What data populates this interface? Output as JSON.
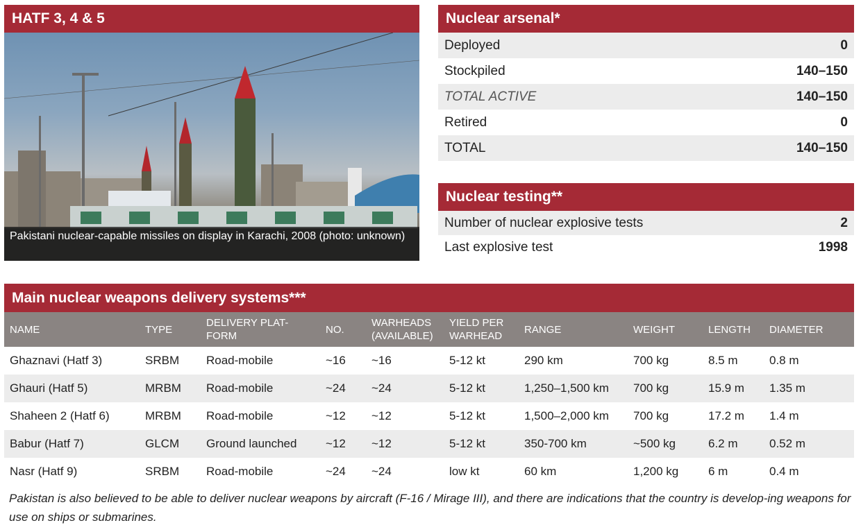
{
  "photo_panel": {
    "title": "HATF 3, 4 & 5",
    "caption": "Pakistani nuclear-capable missiles on display in Karachi, 2008 (photo: unknown)"
  },
  "arsenal": {
    "title": "Nuclear arsenal*",
    "rows": [
      {
        "label": "Deployed",
        "value": "0"
      },
      {
        "label": "Stockpiled",
        "value": "140–150"
      },
      {
        "label": "TOTAL ACTIVE",
        "value": "140–150"
      },
      {
        "label": "Retired",
        "value": "0"
      },
      {
        "label": "TOTAL",
        "value": "140–150"
      }
    ]
  },
  "testing": {
    "title": "Nuclear testing**",
    "rows": [
      {
        "label": "Number of nuclear explosive tests",
        "value": "2"
      },
      {
        "label": "Last explosive test",
        "value": "1998"
      }
    ]
  },
  "delivery": {
    "title": "Main nuclear weapons delivery systems***",
    "headers": [
      "NAME",
      "TYPE",
      "DELIVERY PLAT-\nFORM",
      "NO.",
      "WARHEADS\n(AVAILABLE)",
      "YIELD PER\nWARHEAD",
      "RANGE",
      "WEIGHT",
      "LENGTH",
      "DIAMETER"
    ],
    "rows": [
      [
        "Ghaznavi (Hatf 3)",
        "SRBM",
        "Road-mobile",
        "~16",
        "~16",
        "5-12 kt",
        "290 km",
        "700 kg",
        "8.5 m",
        "0.8 m"
      ],
      [
        "Ghauri (Hatf 5)",
        "MRBM",
        "Road-mobile",
        "~24",
        "~24",
        "5-12 kt",
        "1,250–1,500 km",
        "700 kg",
        "15.9 m",
        "1.35 m"
      ],
      [
        "Shaheen 2 (Hatf 6)",
        "MRBM",
        "Road-mobile",
        "~12",
        "~12",
        "5-12 kt",
        "1,500–2,000 km",
        "700 kg",
        "17.2 m",
        "1.4 m"
      ],
      [
        "Babur (Hatf 7)",
        "GLCM",
        "Ground launched",
        "~12",
        "~12",
        "5-12 kt",
        "350-700 km",
        "~500 kg",
        "6.2 m",
        "0.52 m"
      ],
      [
        "Nasr (Hatf 9)",
        "SRBM",
        "Road-mobile",
        "~24",
        "~24",
        "low kt",
        "60 km",
        "1,200 kg",
        "6 m",
        "0.4 m"
      ]
    ]
  },
  "footnote": "Pakistan is also believed to be able to deliver nuclear weapons by aircraft (F-16 / Mirage III), and there are indications that the country is develop-ing weapons for use on ships or submarines.",
  "colors": {
    "header_red": "#a52a36",
    "table_header_gray": "#8a8482",
    "alt_row": "#ececec"
  }
}
